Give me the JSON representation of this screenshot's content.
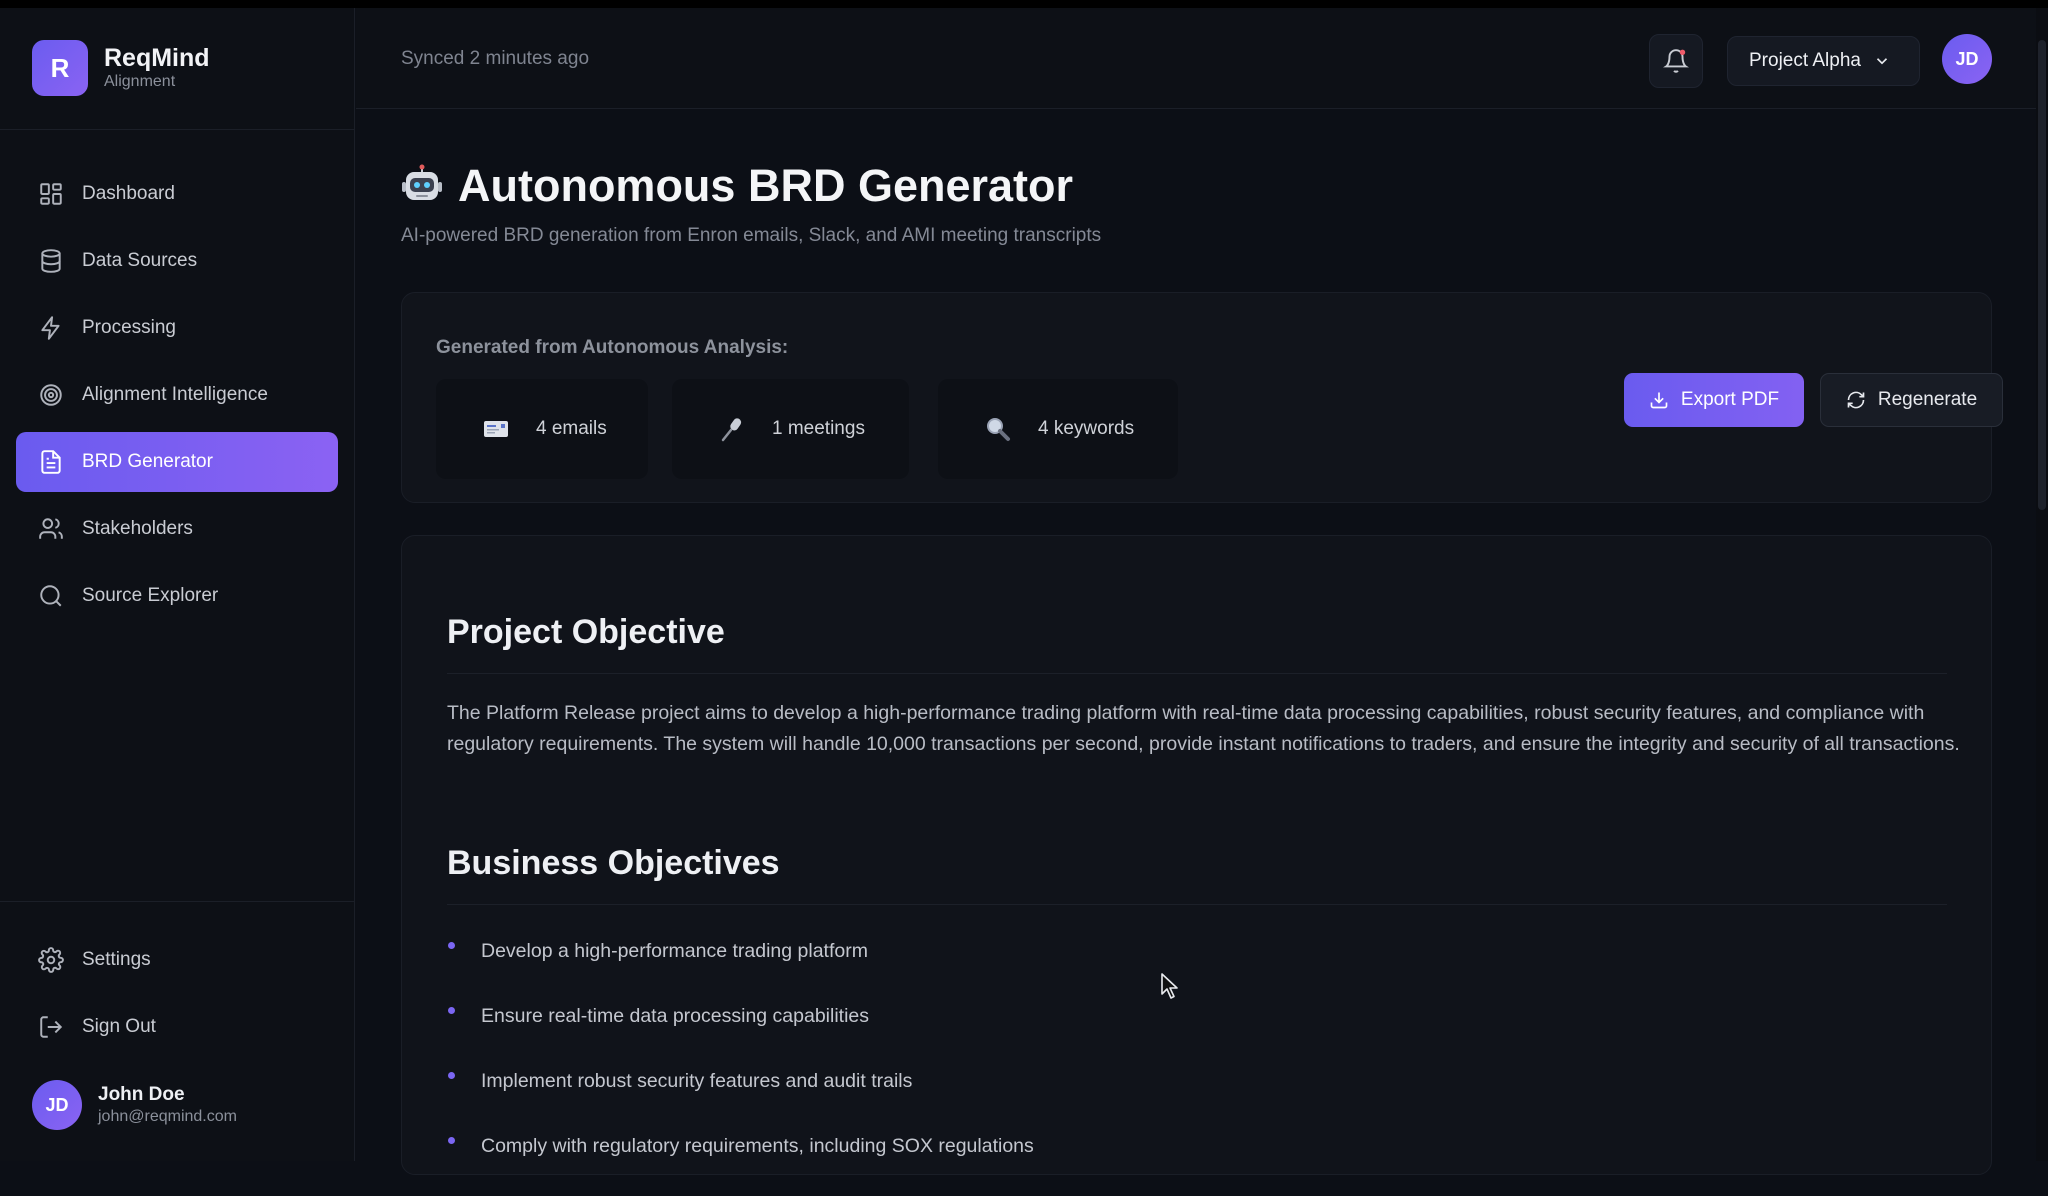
{
  "brand": {
    "logo_letter": "R",
    "name": "ReqMind",
    "subtitle": "Alignment"
  },
  "sidebar": {
    "items": [
      {
        "label": "Dashboard",
        "icon": "dashboard-icon",
        "active": false
      },
      {
        "label": "Data Sources",
        "icon": "database-icon",
        "active": false
      },
      {
        "label": "Processing",
        "icon": "lightning-icon",
        "active": false
      },
      {
        "label": "Alignment Intelligence",
        "icon": "target-icon",
        "active": false
      },
      {
        "label": "BRD Generator",
        "icon": "document-icon",
        "active": true
      },
      {
        "label": "Stakeholders",
        "icon": "users-icon",
        "active": false
      },
      {
        "label": "Source Explorer",
        "icon": "search-icon",
        "active": false
      }
    ],
    "bottom_items": [
      {
        "label": "Settings",
        "icon": "gear-icon"
      },
      {
        "label": "Sign Out",
        "icon": "sign-out-icon"
      }
    ],
    "user": {
      "initials": "JD",
      "name": "John Doe",
      "email": "john@reqmind.com"
    }
  },
  "header": {
    "synced": "Synced 2 minutes ago",
    "project": "Project Alpha",
    "avatar_initials": "JD"
  },
  "page": {
    "title": "Autonomous BRD Generator",
    "subtitle": "AI-powered BRD generation from Enron emails, Slack, and AMI meeting transcripts"
  },
  "analysis": {
    "label": "Generated from Autonomous Analysis:",
    "stats": [
      {
        "icon": "email-icon",
        "text": "4 emails"
      },
      {
        "icon": "microphone-icon",
        "text": "1 meetings"
      },
      {
        "icon": "magnifier-icon",
        "text": "4 keywords"
      }
    ],
    "export_label": "Export PDF",
    "regenerate_label": "Regenerate"
  },
  "document": {
    "objective_heading": "Project Objective",
    "objective_text": "The Platform Release project aims to develop a high-performance trading platform with real-time data processing capabilities, robust security features, and compliance with regulatory requirements. The system will handle 10,000 transactions per second, provide instant notifications to traders, and ensure the integrity and security of all transactions.",
    "business_heading": "Business Objectives",
    "business_items": [
      "Develop a high-performance trading platform",
      "Ensure real-time data processing capabilities",
      "Implement robust security features and audit trails",
      "Comply with regulatory requirements, including SOX regulations"
    ]
  },
  "colors": {
    "accent": "#6a5bef",
    "accent_end": "#8b62f3",
    "background": "#0c0f16"
  }
}
